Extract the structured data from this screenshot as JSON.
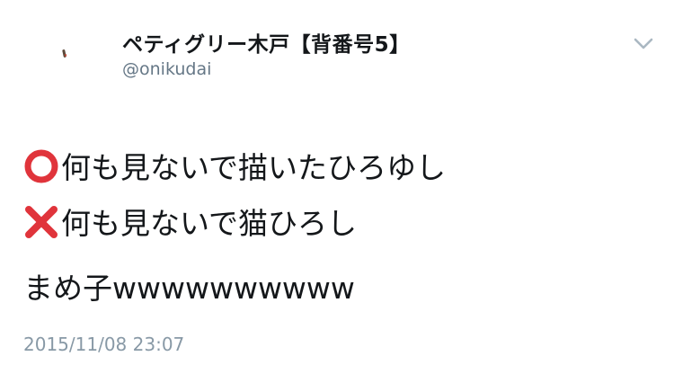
{
  "tweet": {
    "display_name": "ペティグリー木戸【背番号5】",
    "screen_name": "@onikudai",
    "lines": [
      {
        "mark": "circle-mark",
        "text": "何も見ないで描いたひろゆし"
      },
      {
        "mark": "cross-mark",
        "text": "何も見ないで猫ひろし"
      },
      {
        "mark": "",
        "text": "まめ子wwwwwwwwww"
      }
    ],
    "timestamp": "2015/11/08 23:07"
  },
  "colors": {
    "text": "#14171a",
    "secondary": "#657786",
    "timestamp": "#8899a6",
    "mark_red": "#e0343b"
  },
  "icons": {
    "more": "chevron-down-icon",
    "circle": "heavy-large-circle-icon",
    "cross": "cross-mark-icon"
  }
}
